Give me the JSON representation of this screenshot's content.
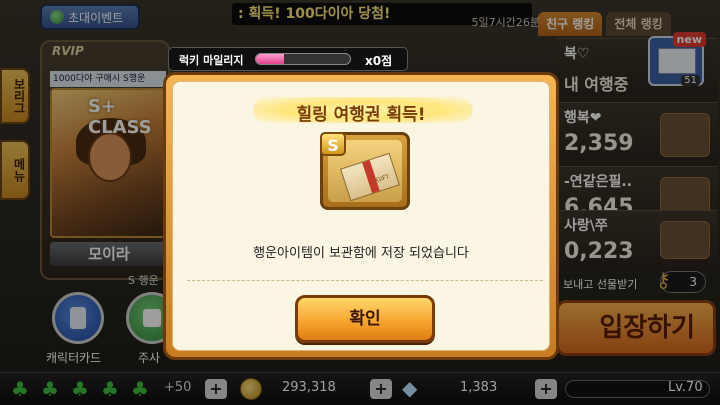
{
  "header": {
    "event_button": "초대이벤트",
    "ticker": ": 획득! 100다이아 당첨!",
    "timer": "5일7시간26분",
    "tabs": [
      "친구 랭킹",
      "전체 랭킹"
    ]
  },
  "left": {
    "side_tab_1": "보리그",
    "side_tab_2": "메뉴",
    "rvip": "RVIP",
    "buy_line": "1000다야 구매시 S행운",
    "class_text": "S+ CLASS",
    "char_name": "모이라",
    "s_line": "S 행운",
    "buttons": [
      {
        "label": "캐릭터카드",
        "icon": "character-card-icon"
      },
      {
        "label": "주사",
        "icon": "dice-icon"
      }
    ]
  },
  "rankings": {
    "mail_new": "new",
    "mail_count": "51",
    "rows": [
      {
        "name": "복♡",
        "sub": "내 여행중",
        "score": ""
      },
      {
        "name": "행복❤",
        "sub": "",
        "score": "2,359"
      },
      {
        "name": "-연같은필..",
        "sub": "",
        "score": "6,645"
      },
      {
        "name": "사랑\\쭈",
        "sub": "",
        "score": "0,223"
      }
    ],
    "send_label": "보내고 선물받기",
    "keys": "3",
    "enter_button": "입장하기"
  },
  "bottom": {
    "clovers": 5,
    "plus": "+50",
    "gold": "293,318",
    "diamonds": "1,383",
    "level": "Lv.70"
  },
  "mileage": {
    "label": "럭키 마일리지",
    "fill_percent": 30,
    "value": "x0점"
  },
  "dialog": {
    "title": "힐링 여행권 획득!",
    "item_badge": "S",
    "item_text": "GIFT",
    "message": "행운아이템이 보관함에 저장 되었습니다",
    "ok_button": "확인"
  }
}
